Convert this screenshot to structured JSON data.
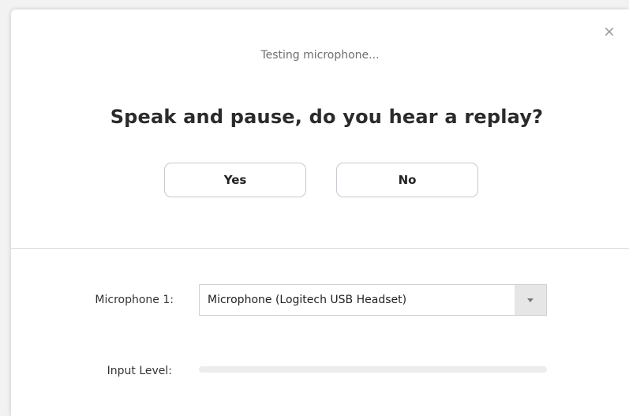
{
  "dialog": {
    "status": "Testing microphone...",
    "prompt": "Speak and pause, do you hear a replay?",
    "close_symbol": "×",
    "yes_label": "Yes",
    "no_label": "No"
  },
  "settings": {
    "microphone_label": "Microphone 1:",
    "microphone_selected": "Microphone (Logitech USB Headset)",
    "input_level_label": "Input Level:",
    "input_level_value": 0
  },
  "icons": {
    "close": "close-icon",
    "dropdown": "caret-down-icon"
  },
  "colors": {
    "level_fill": "#2d8cff",
    "level_track": "#ececec"
  }
}
